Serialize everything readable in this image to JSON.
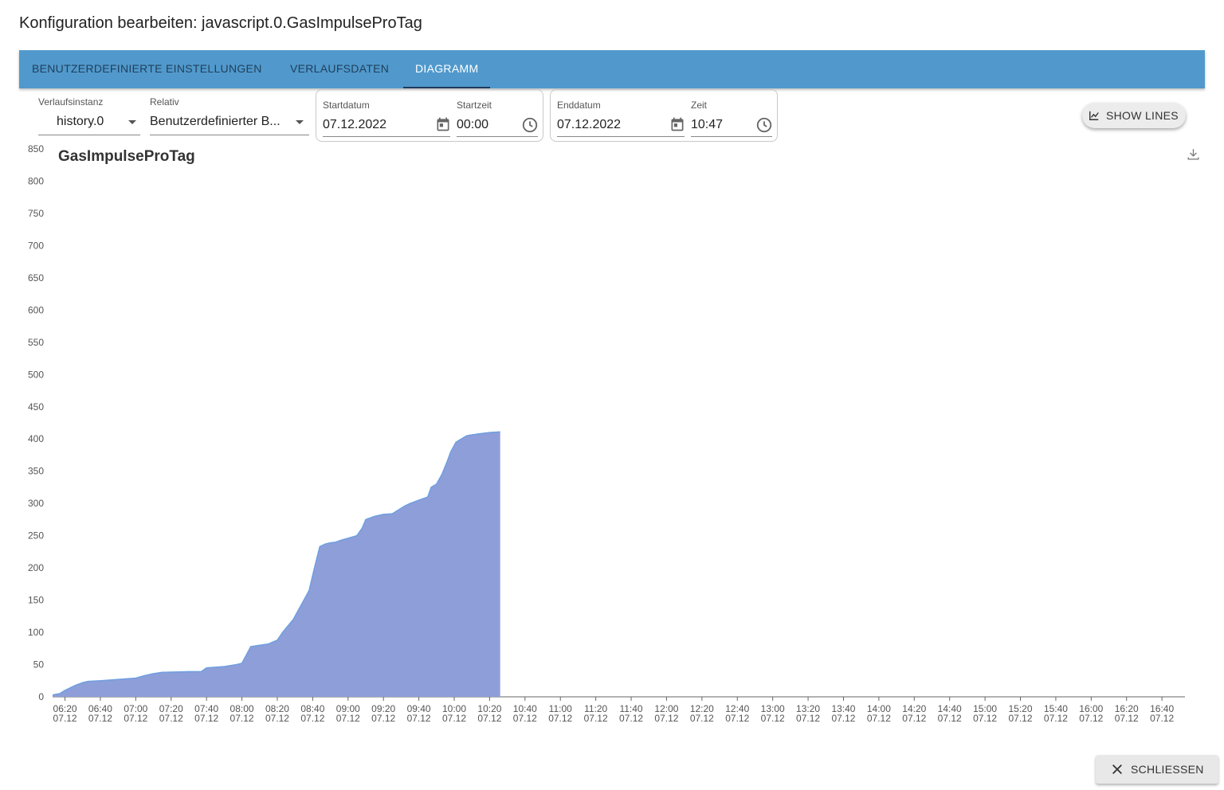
{
  "dialog": {
    "title": "Konfiguration bearbeiten: javascript.0.GasImpulseProTag"
  },
  "tabs": [
    {
      "label": "BENUTZERDEFINIERTE EINSTELLUNGEN",
      "active": false
    },
    {
      "label": "VERLAUFSDATEN",
      "active": false
    },
    {
      "label": "DIAGRAMM",
      "active": true
    }
  ],
  "controls": {
    "instance": {
      "label": "Verlaufsinstanz",
      "value": "history.0"
    },
    "relative": {
      "label": "Relativ",
      "value": "Benutzerdefinierter B..."
    },
    "start_date": {
      "label": "Startdatum",
      "value": "07.12.2022"
    },
    "start_time": {
      "label": "Startzeit",
      "value": "00:00"
    },
    "end_date": {
      "label": "Enddatum",
      "value": "07.12.2022"
    },
    "end_time": {
      "label": "Zeit",
      "value": "10:47"
    },
    "show_lines": "SHOW LINES"
  },
  "footer": {
    "close_label": "SCHLIESSEN"
  },
  "colors": {
    "tabbar": "#5199cc",
    "area_fill": "#8e9ed8",
    "area_line": "#6f9fe0"
  },
  "chart_data": {
    "type": "area",
    "title": "GasImpulseProTag",
    "xlabel": "",
    "ylabel": "",
    "ylim": [
      0,
      850
    ],
    "y_ticks": [
      0,
      50,
      100,
      150,
      200,
      250,
      300,
      350,
      400,
      450,
      500,
      550,
      600,
      650,
      700,
      750,
      800,
      850
    ],
    "x_tick_labels": [
      [
        "06:20",
        "07.12"
      ],
      [
        "06:40",
        "07.12"
      ],
      [
        "07:00",
        "07.12"
      ],
      [
        "07:20",
        "07.12"
      ],
      [
        "07:40",
        "07.12"
      ],
      [
        "08:00",
        "07.12"
      ],
      [
        "08:20",
        "07.12"
      ],
      [
        "08:40",
        "07.12"
      ],
      [
        "09:00",
        "07.12"
      ],
      [
        "09:20",
        "07.12"
      ],
      [
        "09:40",
        "07.12"
      ],
      [
        "10:00",
        "07.12"
      ],
      [
        "10:20",
        "07.12"
      ],
      [
        "10:40",
        "07.12"
      ],
      [
        "11:00",
        "07.12"
      ],
      [
        "11:20",
        "07.12"
      ],
      [
        "11:40",
        "07.12"
      ],
      [
        "12:00",
        "07.12"
      ],
      [
        "12:20",
        "07.12"
      ],
      [
        "12:40",
        "07.12"
      ],
      [
        "13:00",
        "07.12"
      ],
      [
        "13:20",
        "07.12"
      ],
      [
        "13:40",
        "07.12"
      ],
      [
        "14:00",
        "07.12"
      ],
      [
        "14:20",
        "07.12"
      ],
      [
        "14:40",
        "07.12"
      ],
      [
        "15:00",
        "07.12"
      ],
      [
        "15:20",
        "07.12"
      ],
      [
        "15:40",
        "07.12"
      ],
      [
        "16:00",
        "07.12"
      ],
      [
        "16:20",
        "07.12"
      ],
      [
        "16:40",
        "07.12"
      ]
    ],
    "xlim": [
      "06:13",
      "16:53"
    ],
    "grid": false,
    "legend": "none",
    "series": [
      {
        "x": [
          "06:13",
          "06:17",
          "06:20",
          "06:23",
          "06:26",
          "06:30",
          "06:33",
          "06:40",
          "06:50",
          "07:00",
          "07:05",
          "07:10",
          "07:15",
          "07:30",
          "07:37",
          "07:40",
          "07:50",
          "07:57",
          "08:00",
          "08:05",
          "08:10",
          "08:15",
          "08:20",
          "08:23",
          "08:26",
          "08:29",
          "08:32",
          "08:35",
          "08:38",
          "08:41",
          "08:44",
          "08:47",
          "08:50",
          "08:53",
          "08:56",
          "09:00",
          "09:05",
          "09:08",
          "09:10",
          "09:13",
          "09:15",
          "09:20",
          "09:25",
          "09:32",
          "09:35",
          "09:40",
          "09:45",
          "09:47",
          "09:50",
          "09:53",
          "09:56",
          "09:58",
          "10:01",
          "10:04",
          "10:07",
          "10:09",
          "10:14",
          "10:20",
          "10:26"
        ],
        "y": [
          3,
          5,
          10,
          14,
          18,
          22,
          24,
          25,
          27,
          29,
          33,
          36,
          38,
          39,
          39,
          45,
          47,
          50,
          52,
          78,
          80,
          82,
          88,
          100,
          110,
          120,
          135,
          150,
          165,
          200,
          233,
          237,
          239,
          240,
          243,
          246,
          250,
          262,
          275,
          278,
          280,
          283,
          284,
          296,
          300,
          305,
          310,
          325,
          330,
          345,
          365,
          380,
          395,
          400,
          405,
          406,
          408,
          410,
          411
        ]
      }
    ]
  }
}
